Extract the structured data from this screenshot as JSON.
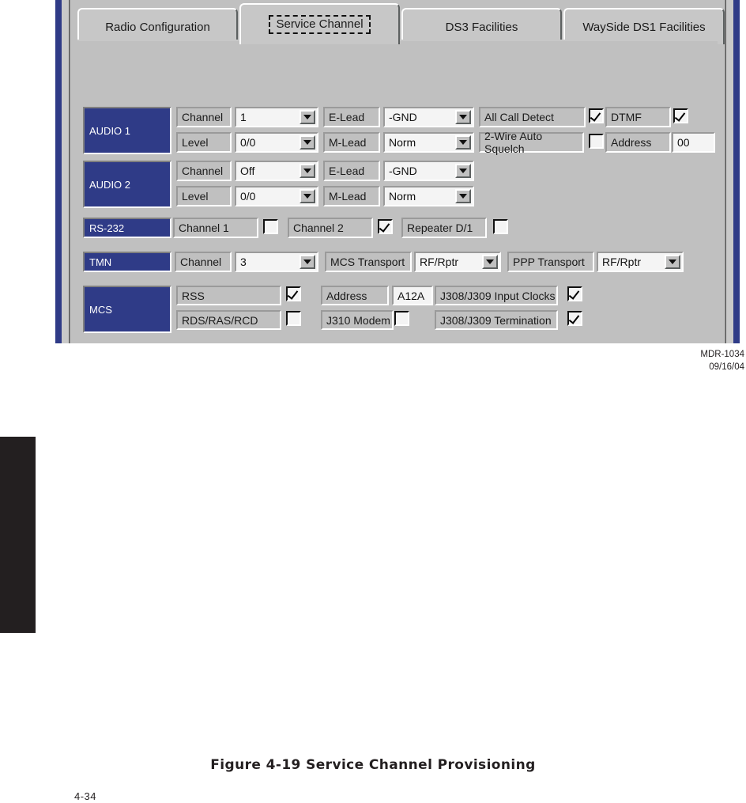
{
  "document": {
    "figure_caption": "Figure 4-19  Service Channel Provisioning",
    "page_number": "4-34",
    "credit_id": "MDR-1034",
    "credit_date": "09/16/04"
  },
  "window": {
    "tabs": [
      {
        "label": "Radio Configuration",
        "active": false
      },
      {
        "label": "Service Channel",
        "active": true
      },
      {
        "label": "DS3 Facilities",
        "active": false
      },
      {
        "label": "WaySide DS1 Facilities",
        "active": false
      }
    ]
  },
  "sections": {
    "audio1": {
      "title": "AUDIO 1",
      "channel_label": "Channel",
      "channel_value": "1",
      "level_label": "Level",
      "level_value": "0/0",
      "elead_label": "E-Lead",
      "elead_value": "-GND",
      "mlead_label": "M-Lead",
      "mlead_value": "Norm",
      "all_call_label": "All Call Detect",
      "all_call_checked": true,
      "dtmf_label": "DTMF",
      "dtmf_checked": true,
      "squelch_label": "2-Wire Auto Squelch",
      "squelch_checked": false,
      "address_label": "Address",
      "address_value": "00"
    },
    "audio2": {
      "title": "AUDIO 2",
      "channel_label": "Channel",
      "channel_value": "Off",
      "level_label": "Level",
      "level_value": "0/0",
      "elead_label": "E-Lead",
      "elead_value": "-GND",
      "mlead_label": "M-Lead",
      "mlead_value": "Norm"
    },
    "rs232": {
      "title": "RS-232",
      "channel1_label": "Channel 1",
      "channel1_checked": false,
      "channel2_label": "Channel 2",
      "channel2_checked": true,
      "repeater_label": "Repeater D/1",
      "repeater_checked": false
    },
    "tmn": {
      "title": "TMN",
      "channel_label": "Channel",
      "channel_value": "3",
      "mcs_transport_label": "MCS Transport",
      "mcs_transport_value": "RF/Rptr",
      "ppp_transport_label": "PPP Transport",
      "ppp_transport_value": "RF/Rptr"
    },
    "mcs": {
      "title": "MCS",
      "rss_label": "RSS",
      "rss_checked": true,
      "rds_label": "RDS/RAS/RCD",
      "rds_checked": false,
      "address_label": "Address",
      "address_value": "A12A",
      "j310_label": "J310 Modem",
      "j310_checked": false,
      "input_clocks_label": "J308/J309 Input Clocks",
      "input_clocks_checked": true,
      "termination_label": "J308/J309 Termination",
      "termination_checked": true
    }
  },
  "colors": {
    "title_blue": "#2f3b87",
    "face_gray": "#c0c0c0",
    "field_white": "#f4f4f4"
  }
}
